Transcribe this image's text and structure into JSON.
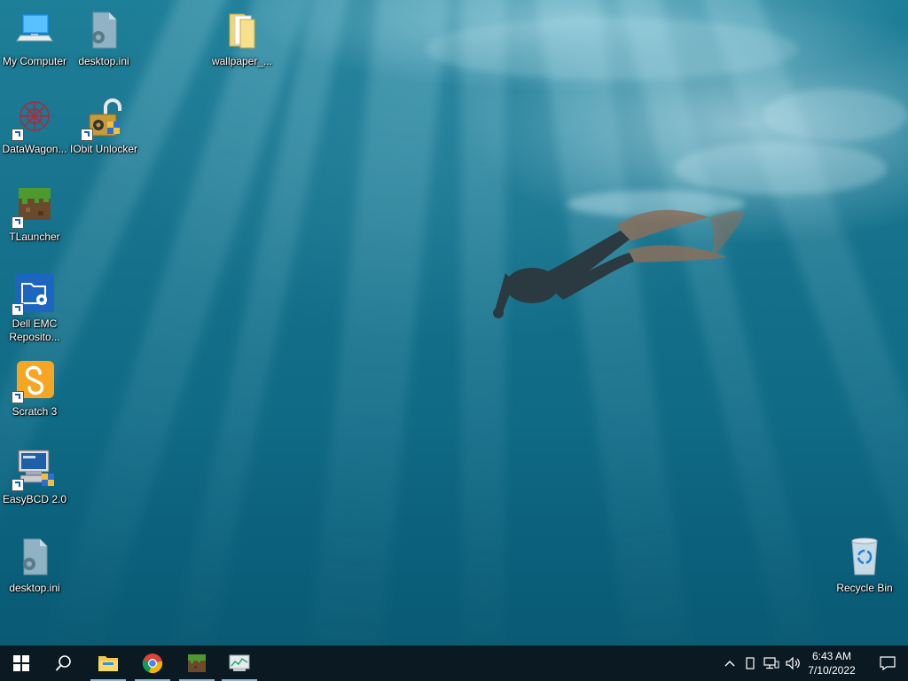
{
  "desktop": {
    "icons": [
      {
        "label": "My Computer"
      },
      {
        "label": "desktop.ini"
      },
      {
        "label": "wallpaper_..."
      },
      {
        "label": "DataWagon..."
      },
      {
        "label": "IObit Unlocker"
      },
      {
        "label": "TLauncher"
      },
      {
        "label": "Dell EMC Reposito..."
      },
      {
        "label": "Scratch 3"
      },
      {
        "label": "EasyBCD 2.0"
      },
      {
        "label": "desktop.ini"
      },
      {
        "label": "Recycle Bin"
      }
    ]
  },
  "taskbar": {
    "pinned": [
      {
        "icon": "windows-start-icon",
        "running": false
      },
      {
        "icon": "search-icon",
        "running": false
      },
      {
        "icon": "file-explorer-icon",
        "running": true
      },
      {
        "icon": "chrome-icon",
        "running": true
      },
      {
        "icon": "tlauncher-icon",
        "running": true
      },
      {
        "icon": "network-monitor-icon",
        "running": true
      }
    ],
    "tray": {
      "time": "6:43 AM",
      "date": "7/10/2022"
    }
  },
  "colors": {
    "taskbar_bg": "#0b1a22",
    "running_indicator": "#8db6d4",
    "water": "#14708a"
  }
}
